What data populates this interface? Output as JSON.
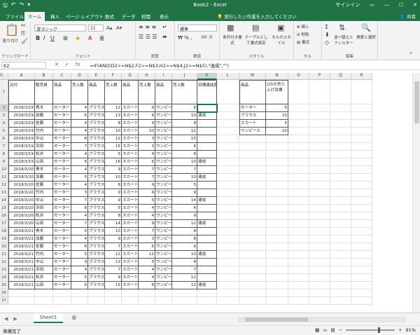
{
  "window": {
    "title": "Book2 - Excel",
    "signin": "サインイン",
    "qat_icons": [
      "save-icon",
      "undo-icon",
      "redo-icon",
      "customize-icon"
    ]
  },
  "tabs": [
    "ファイル",
    "ホーム",
    "挿入",
    "ページ レイアウト",
    "数式",
    "データ",
    "校閲",
    "表示"
  ],
  "active_tab": "ホーム",
  "tell_me": "実行したい作業を入力してください",
  "share": "共有",
  "ribbon": {
    "clipboard": {
      "label": "クリップボード",
      "paste": "貼り付け"
    },
    "font": {
      "label": "フォント",
      "name": "游ゴシック",
      "size": "11",
      "bold": "B",
      "italic": "I",
      "underline": "U"
    },
    "alignment": {
      "label": "配置"
    },
    "number": {
      "label": "数値",
      "format": "標準"
    },
    "styles": {
      "label": "スタイル",
      "conditional": "条件付き書式",
      "table": "テーブルとして書式設定",
      "cell": "セルのスタイル"
    },
    "cells": {
      "label": "セル",
      "insert": "挿入",
      "delete": "削除",
      "format": "書式"
    },
    "editing": {
      "label": "編集",
      "sort": "並べ替えとフィルター",
      "find": "検索と選択"
    }
  },
  "formula_bar": {
    "namebox": "K2",
    "formula": "=IF(AND(D2>=N$2,F2>=N$3,H2>=N$4,J2>=N$5),\"達成\",\"\")"
  },
  "columns": [
    "A",
    "B",
    "C",
    "D",
    "E",
    "F",
    "G",
    "H",
    "I",
    "J",
    "K",
    "L",
    "M",
    "N",
    "O",
    "P",
    "Q",
    "R",
    "S"
  ],
  "headers": {
    "A1": "日付",
    "B1": "販売員",
    "C1": "商品",
    "D1": "売上数",
    "E1": "商品",
    "F1": "売上数",
    "G1": "商品",
    "H1": "売上数",
    "I1": "商品",
    "J1": "売上数",
    "K1": "目標達成度",
    "M1": "商品",
    "N1": "1日の売り上げ目標"
  },
  "sales": [
    [
      "2018/3/19",
      "青木",
      "セーター",
      "4",
      "ブラウス",
      "12",
      "スカート",
      "6",
      "ワンピース",
      "6",
      ""
    ],
    [
      "2018/3/19",
      "加藤",
      "セーター",
      "6",
      "ブラウス",
      "13",
      "スカート",
      "6",
      "ワンピース",
      "10",
      "達成"
    ],
    [
      "2018/3/19",
      "佐藤",
      "セーター",
      "4",
      "ブラウス",
      "8",
      "スカート",
      "4",
      "ワンピース",
      "8",
      ""
    ],
    [
      "2018/3/19",
      "竹内",
      "セーター",
      "4",
      "ブラウス",
      "10",
      "スカート",
      "10",
      "ワンピース",
      "12",
      ""
    ],
    [
      "2018/3/19",
      "中山",
      "セーター",
      "8",
      "ブラウス",
      "12",
      "スカート",
      "3",
      "ワンピース",
      "15",
      ""
    ],
    [
      "2018/3/19",
      "浜田",
      "セーター",
      "7",
      "ブラウス",
      "15",
      "スカート",
      "3",
      "ワンピース",
      "6",
      ""
    ],
    [
      "2018/3/19",
      "松井",
      "セーター",
      "4",
      "ブラウス",
      "5",
      "スカート",
      "4",
      "ワンピース",
      "8",
      ""
    ],
    [
      "2018/3/19",
      "山田",
      "セーター",
      "6",
      "ブラウス",
      "16",
      "スカート",
      "6",
      "ワンピース",
      "10",
      "達成"
    ],
    [
      "2018/3/20",
      "青木",
      "セーター",
      "4",
      "ブラウス",
      "9",
      "スカート",
      "7",
      "ワンピース",
      "7",
      ""
    ],
    [
      "2018/3/20",
      "加藤",
      "セーター",
      "5",
      "ブラウス",
      "10",
      "スカート",
      "7",
      "ワンピース",
      "10",
      "達成"
    ],
    [
      "2018/3/20",
      "佐藤",
      "セーター",
      "4",
      "ブラウス",
      "8",
      "スカート",
      "9",
      "ワンピース",
      "5",
      ""
    ],
    [
      "2018/3/20",
      "竹内",
      "セーター",
      "3",
      "ブラウス",
      "9",
      "スカート",
      "4",
      "ワンピース",
      "9",
      ""
    ],
    [
      "2018/3/20",
      "中山",
      "セーター",
      "7",
      "ブラウス",
      "9",
      "スカート",
      "5",
      "ワンピース",
      "14",
      "達成"
    ],
    [
      "2018/3/20",
      "浜田",
      "セーター",
      "6",
      "ブラウス",
      "5",
      "スカート",
      "4",
      "ワンピース",
      "6",
      ""
    ],
    [
      "2018/3/20",
      "松井",
      "セーター",
      "4",
      "ブラウス",
      "8",
      "スカート",
      "4",
      "ワンピース",
      "9",
      ""
    ],
    [
      "2018/3/20",
      "山田",
      "セーター",
      "7",
      "ブラウス",
      "14",
      "スカート",
      "9",
      "ワンピース",
      "12",
      "達成"
    ],
    [
      "2018/3/21",
      "青木",
      "セーター",
      "5",
      "ブラウス",
      "10",
      "スカート",
      "7",
      "ワンピース",
      "8",
      ""
    ],
    [
      "2018/3/21",
      "加藤",
      "セーター",
      "4",
      "ブラウス",
      "9",
      "スカート",
      "3",
      "ワンピース",
      "8",
      ""
    ],
    [
      "2018/3/21",
      "佐藤",
      "セーター",
      "6",
      "ブラウス",
      "7",
      "スカート",
      "6",
      "ワンピース",
      "6",
      ""
    ],
    [
      "2018/3/21",
      "竹内",
      "セーター",
      "5",
      "ブラウス",
      "12",
      "スカート",
      "12",
      "ワンピース",
      "10",
      "達成"
    ],
    [
      "2018/3/21",
      "中山",
      "セーター",
      "9",
      "ブラウス",
      "12",
      "スカート",
      "5",
      "ワンピース",
      "8",
      ""
    ],
    [
      "2018/3/21",
      "浜田",
      "セーター",
      "4",
      "ブラウス",
      "7",
      "スカート",
      "4",
      "ワンピース",
      "7",
      ""
    ],
    [
      "2018/3/21",
      "松井",
      "セーター",
      "5",
      "ブラウス",
      "9",
      "スカート",
      "4",
      "ワンピース",
      "12",
      ""
    ],
    [
      "2018/3/21",
      "山田",
      "セーター",
      "6",
      "ブラウス",
      "15",
      "スカート",
      "6",
      "ワンピース",
      "12",
      "達成"
    ]
  ],
  "targets": [
    [
      "セーター",
      "5"
    ],
    [
      "ブラウス",
      "10"
    ],
    [
      "スカート",
      "5"
    ],
    [
      "ワンピース",
      "10"
    ]
  ],
  "sheet_tab": "Sheet1",
  "status": "準備完了",
  "zoom": "91%",
  "colors": {
    "accent": "#217346"
  }
}
